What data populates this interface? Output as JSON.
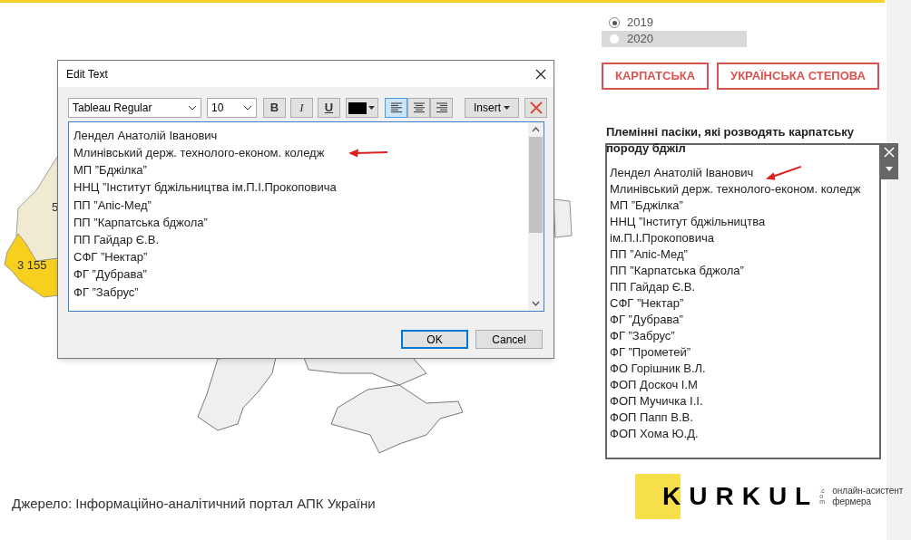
{
  "map": {
    "labels": [
      {
        "text": "5",
        "kind": "region"
      },
      {
        "text": "3 155",
        "kind": "highlight"
      }
    ]
  },
  "dialog": {
    "title": "Edit Text",
    "font": "Tableau Regular",
    "size": "10",
    "format_buttons": [
      {
        "label": "B",
        "kind": "bold"
      },
      {
        "label": "I",
        "kind": "italic"
      },
      {
        "label": "U",
        "kind": "underline"
      }
    ],
    "alignments": [
      {
        "kind": "left",
        "selected": true
      },
      {
        "kind": "center",
        "selected": false
      },
      {
        "kind": "right",
        "selected": false
      }
    ],
    "insert_button": "Insert",
    "lines": [
      {
        "text": "Лендел Анатолій Іванович",
        "arrow": false
      },
      {
        "text": "Млинівський держ. технолого-економ. коледж",
        "arrow": true
      },
      {
        "text": "МП ”Бджілка”",
        "arrow": false
      },
      {
        "text": "ННЦ ”Інститут бджільництва ім.П.І.Прокоповича",
        "arrow": false
      },
      {
        "text": "ПП ”Апіс-Мед”",
        "arrow": false
      },
      {
        "text": "ПП ”Карпатська бджола”",
        "arrow": false
      },
      {
        "text": "ПП Гайдар Є.В.",
        "arrow": false
      },
      {
        "text": "СФГ ”Нектар”",
        "arrow": false
      },
      {
        "text": "ФГ ”Дубрава”",
        "arrow": false
      },
      {
        "text": "ФГ ”Забрус”",
        "arrow": false
      }
    ],
    "buttons": [
      {
        "label": "OK",
        "default": true
      },
      {
        "label": "Cancel",
        "default": false
      }
    ]
  },
  "years": [
    {
      "label": "2019",
      "selected": true,
      "hovered": false
    },
    {
      "label": "2020",
      "selected": false,
      "hovered": true
    }
  ],
  "breed_buttons": [
    "КАРПАТСЬКА",
    "УКРАЇНСЬКА СТЕПОВА"
  ],
  "panel": {
    "heading": "Племінні пасіки, які розводять карпатську породу бджіл",
    "lines": [
      {
        "text": "Лендел Анатолій Іванович",
        "arrow": true
      },
      "Млинівський держ. технолого-економ. коледж",
      "МП ”Бджілка”",
      "ННЦ ”Інститут бджільництва",
      "ім.П.І.Прокоповича",
      "ПП ”Апіс-Мед”",
      "ПП ”Карпатська бджола”",
      "ПП Гайдар Є.В.",
      "СФГ ”Нектар”",
      "ФГ ”Дубрава”",
      "ФГ ”Забрус”",
      "ФГ ”Прометей”",
      "ФО Горішник В.Л.",
      "ФОП Доскоч І.М",
      "ФОП Мучичка І.І.",
      "ФОП Папп В.В.",
      "ФОП Хома Ю.Д."
    ]
  },
  "source": "Джерело: Інформаційно-аналітичний портал АПК України",
  "logo": {
    "name": "KURKUL",
    "domain": ".com",
    "tagline": [
      "онлайн-асистент",
      "фермера"
    ]
  }
}
